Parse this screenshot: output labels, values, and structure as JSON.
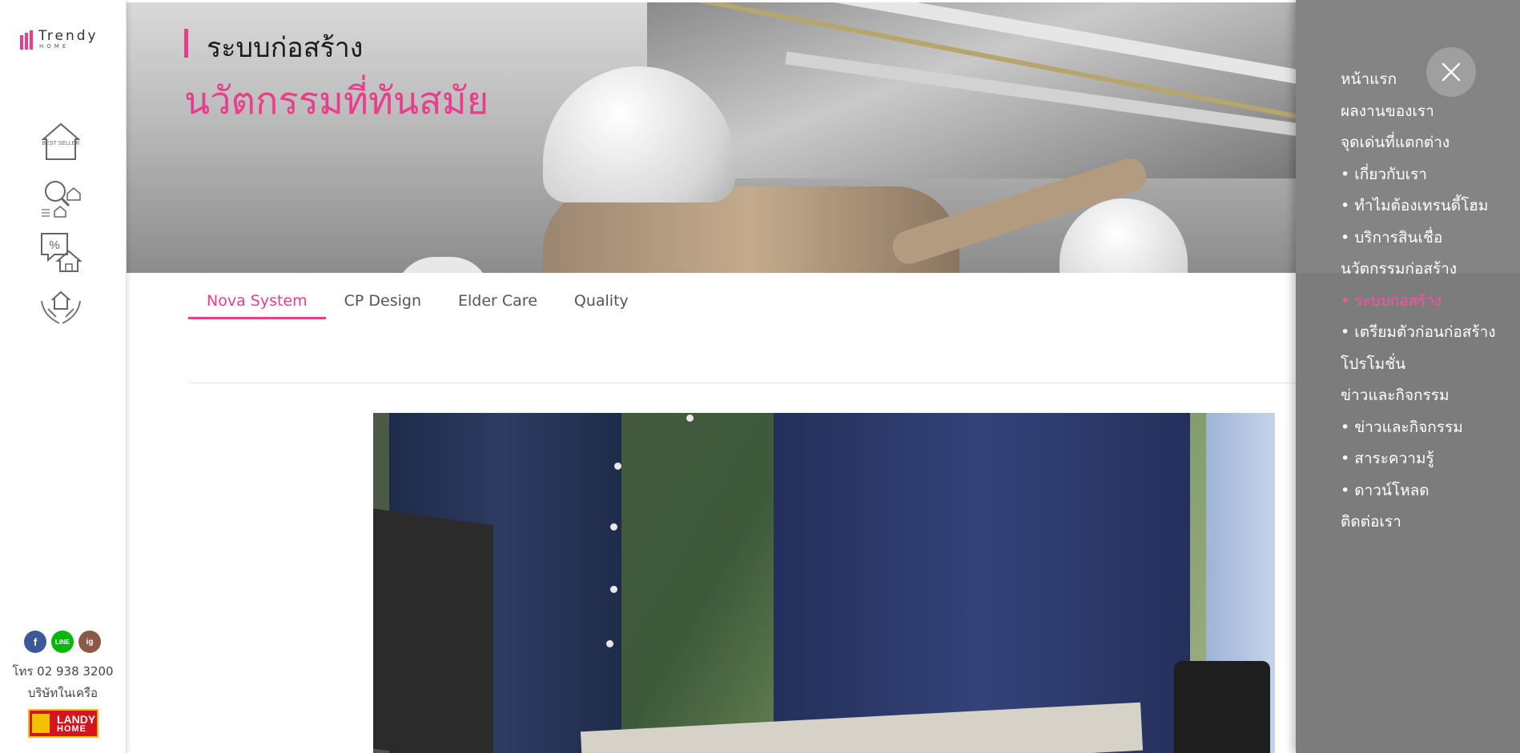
{
  "sidebar": {
    "logo": {
      "brand": "Trendy",
      "sub": "HOME"
    },
    "icons": [
      {
        "name": "best-seller-icon",
        "label": "BEST SELLER"
      },
      {
        "name": "house-search-icon"
      },
      {
        "name": "promotion-house-icon",
        "label": "%"
      },
      {
        "name": "hands-house-icon"
      }
    ],
    "social": {
      "facebook": "f",
      "line": "LINE",
      "instagram": "ig"
    },
    "phone": "โทร 02 938 3200",
    "affiliate": "บริษัทในเครือ",
    "partner": {
      "name": "LANDY",
      "sub": "HOME"
    }
  },
  "hero": {
    "title": "ระบบก่อสร้าง",
    "subtitle": "นวัตกรรมที่ทันสมัย"
  },
  "tabs": [
    {
      "label": "Nova System",
      "active": true
    },
    {
      "label": "CP Design",
      "active": false
    },
    {
      "label": "Elder Care",
      "active": false
    },
    {
      "label": "Quality",
      "active": false
    }
  ],
  "menu": {
    "close_label": "×",
    "items": [
      {
        "label": "หน้าแรก"
      },
      {
        "label": "ผลงานของเรา"
      },
      {
        "label": "จุดเด่นที่แตกต่าง"
      },
      {
        "label": "• เกี่ยวกับเรา"
      },
      {
        "label": "• ทำไมต้องเทรนดี้โฮม"
      },
      {
        "label": "• บริการสินเชื่อ"
      },
      {
        "label": "นวัตกรรมก่อสร้าง"
      },
      {
        "label": "• ระบบก่อสร้าง",
        "active": true
      },
      {
        "label": "• เตรียมตัวก่อนก่อสร้าง"
      },
      {
        "label": "โปรโมชั่น"
      },
      {
        "label": "ข่าวและกิจกรรม"
      },
      {
        "label": "• ข่าวและกิจกรรม"
      },
      {
        "label": "• สาระความรู้"
      },
      {
        "label": "• ดาวน์โหลด"
      },
      {
        "label": "ติดต่อเรา"
      }
    ]
  },
  "colors": {
    "accent": "#e83e8c",
    "menu_active": "#ff4fa0",
    "drawer_bg": "#808080"
  }
}
